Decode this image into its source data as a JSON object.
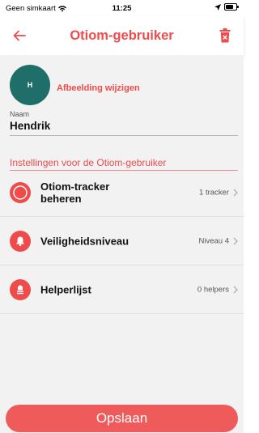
{
  "status_bar": {
    "carrier": "Geen simkaart",
    "time": "11:25"
  },
  "header": {
    "title": "Otiom-gebruiker",
    "back_icon": "arrow-left-icon",
    "delete_icon": "trash-icon"
  },
  "profile": {
    "avatar_initial": "H",
    "change_image_label": "Afbeelding wijzigen",
    "name_label": "Naam",
    "name_value": "Hendrik"
  },
  "settings": {
    "title": "Instellingen voor de Otiom-gebruiker",
    "items": [
      {
        "label": "Otiom-tracker beheren",
        "value": "1 tracker",
        "icon": "tracker-icon"
      },
      {
        "label": "Veiligheidsniveau",
        "value": "Niveau 4",
        "icon": "bell-icon"
      },
      {
        "label": "Helperlijst",
        "value": "0 helpers",
        "icon": "helper-bell-icon"
      }
    ]
  },
  "footer": {
    "save_label": "Opslaan"
  },
  "colors": {
    "accent": "#ef4b4b",
    "avatar": "#1f6e6a",
    "background": "#f2f2f2"
  }
}
